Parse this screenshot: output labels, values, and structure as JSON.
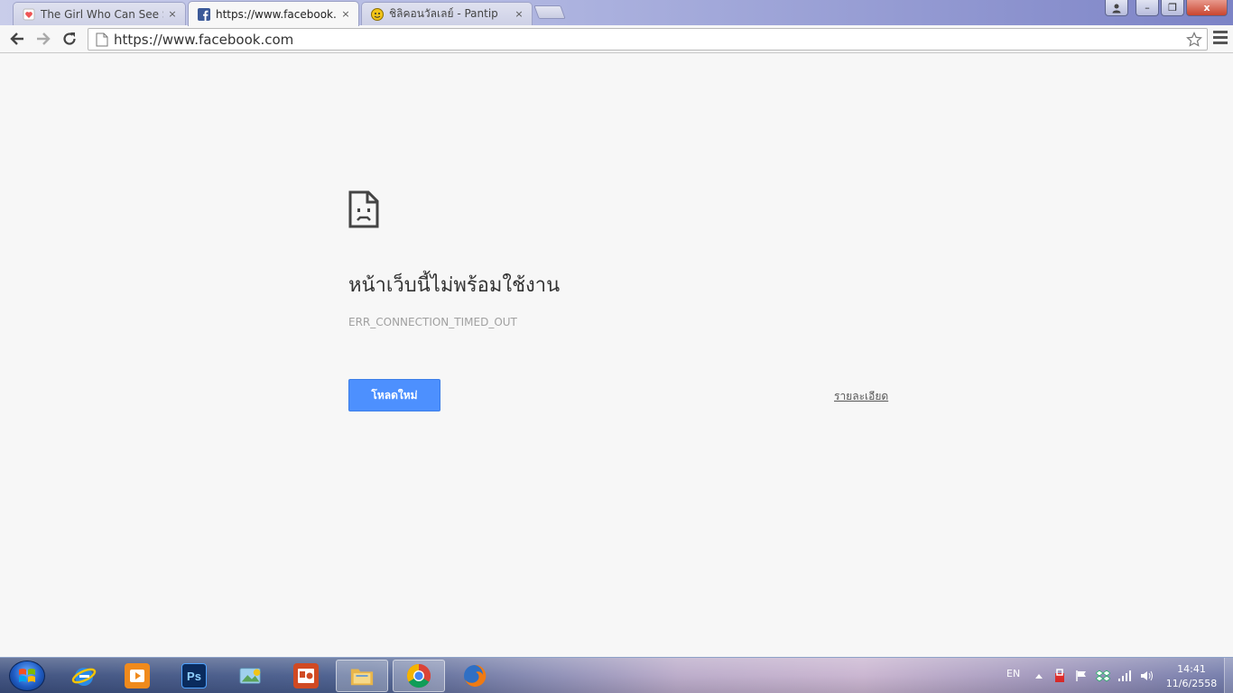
{
  "tabs": [
    {
      "title": "The Girl Who Can See Sme",
      "favicon": "heart-page-icon",
      "active": false
    },
    {
      "title": "https://www.facebook.con",
      "favicon": "facebook-icon",
      "active": true
    },
    {
      "title": "ชิลิคอนวัลเลย์ - Pantip",
      "favicon": "pantip-icon",
      "active": false
    }
  ],
  "tab_close_glyph": "×",
  "window_controls": {
    "minimize": "–",
    "maximize": "❐",
    "close": "x"
  },
  "toolbar": {
    "url": "https://www.facebook.com"
  },
  "error": {
    "title": "หน้าเว็บนี้ไม่พร้อมใช้งาน",
    "code": "ERR_CONNECTION_TIMED_OUT",
    "reload_label": "โหลดใหม่",
    "details_label": "รายละเอียด"
  },
  "taskbar": {
    "pinned": [
      {
        "name": "internet-explorer-icon"
      },
      {
        "name": "media-player-icon"
      },
      {
        "name": "photoshop-icon",
        "label": "Ps"
      },
      {
        "name": "photo-viewer-icon"
      },
      {
        "name": "powerpoint-icon"
      },
      {
        "name": "file-explorer-icon"
      },
      {
        "name": "chrome-icon"
      },
      {
        "name": "firefox-icon"
      }
    ],
    "language": "EN",
    "clock_time": "14:41",
    "clock_date": "11/6/2558"
  },
  "colors": {
    "reload_button": "#4d90fe",
    "page_background": "#f7f7f7"
  }
}
